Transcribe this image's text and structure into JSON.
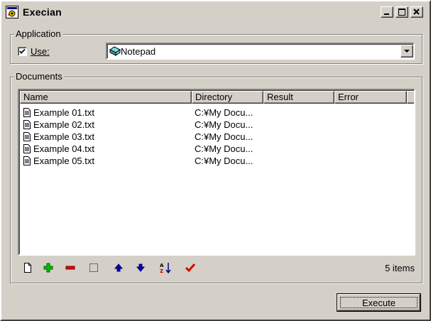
{
  "window": {
    "title": "Execian"
  },
  "application": {
    "group_label": "Application",
    "use_label": "Use:",
    "use_checked": true,
    "selected_app": "Notepad"
  },
  "documents": {
    "group_label": "Documents",
    "columns": [
      "Name",
      "Directory",
      "Result",
      "Error"
    ],
    "rows": [
      {
        "name": "Example 01.txt",
        "directory": "C:¥My Docu..."
      },
      {
        "name": "Example 02.txt",
        "directory": "C:¥My Docu..."
      },
      {
        "name": "Example 03.txt",
        "directory": "C:¥My Docu..."
      },
      {
        "name": "Example 04.txt",
        "directory": "C:¥My Docu..."
      },
      {
        "name": "Example 05.txt",
        "directory": "C:¥My Docu..."
      }
    ],
    "item_count": "5 items"
  },
  "toolbar_icons": [
    "new-icon",
    "add-icon",
    "remove-icon",
    "select-icon",
    "move-up-icon",
    "move-down-icon",
    "sort-az-icon",
    "check-icon"
  ],
  "execute_label": "Execute"
}
